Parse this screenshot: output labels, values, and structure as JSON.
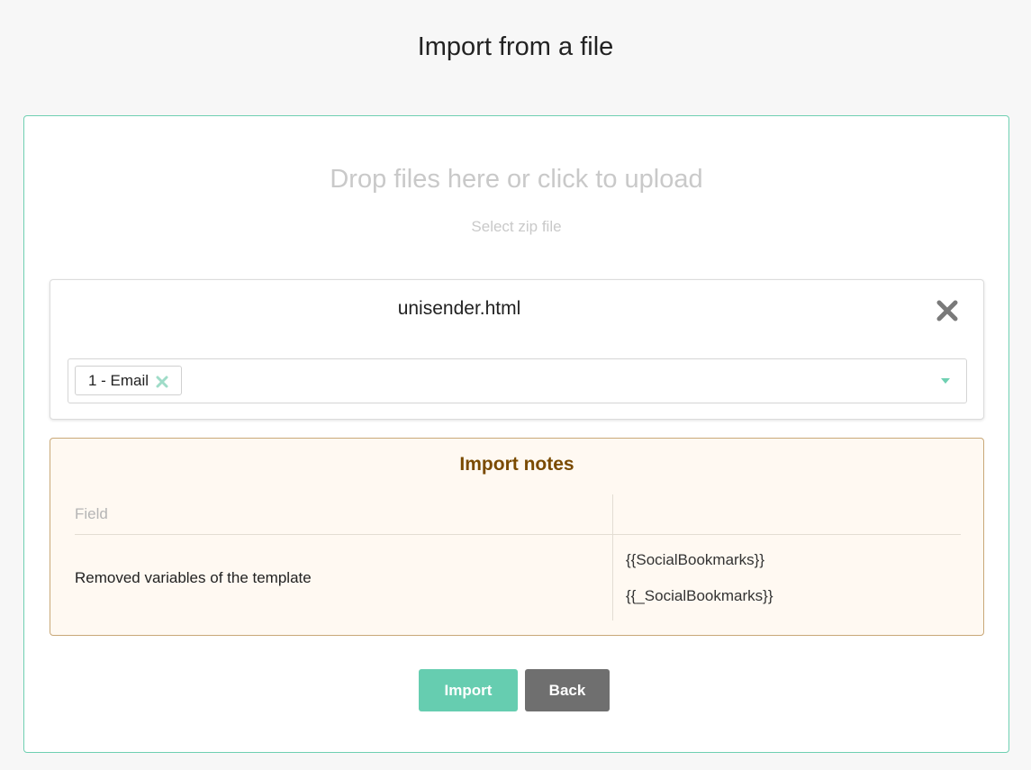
{
  "page": {
    "title": "Import from a file"
  },
  "dropzone": {
    "title": "Drop files here or click to upload",
    "subtitle": "Select zip file"
  },
  "file": {
    "name": "unisender.html",
    "remove_icon": "close-x-icon",
    "selected_tag": "1 - Email",
    "tag_remove_icon": "close-x-icon",
    "caret_icon": "chevron-down-icon"
  },
  "notes": {
    "title": "Import notes",
    "header_field": "Field",
    "header_value": "",
    "rows": [
      {
        "field": "Removed variables of the template",
        "values": [
          "{{SocialBookmarks}}",
          "{{_SocialBookmarks}}"
        ]
      }
    ]
  },
  "actions": {
    "import_label": "Import",
    "back_label": "Back"
  },
  "colors": {
    "accent": "#66cdb0",
    "panel_border": "#6fd0b2",
    "notes_bg": "#fff9f2",
    "notes_border": "#c9a878",
    "notes_title": "#7a4a00",
    "back_button": "#6f6f6f"
  }
}
